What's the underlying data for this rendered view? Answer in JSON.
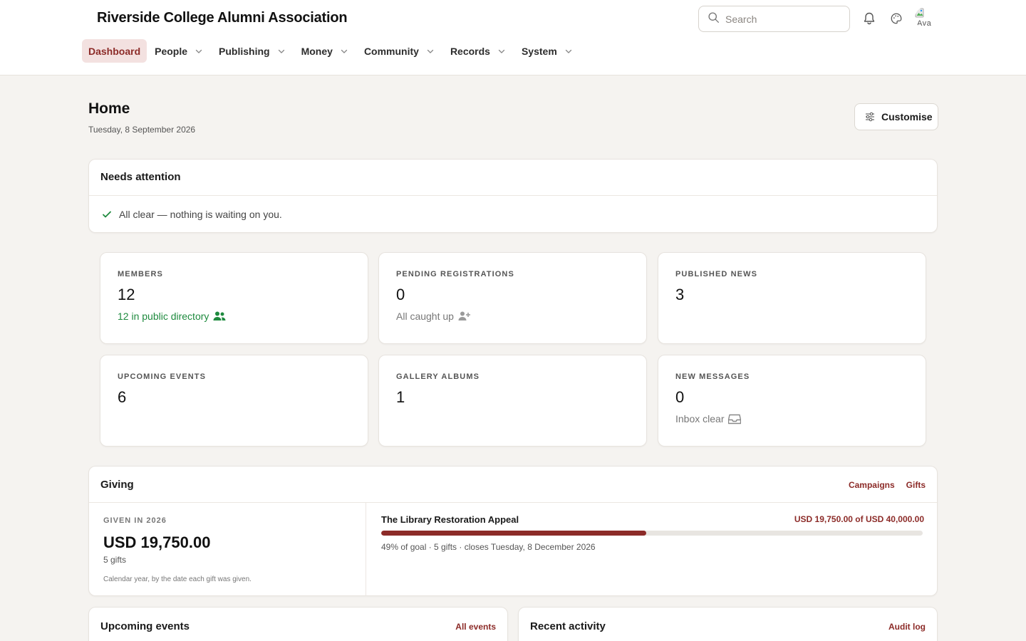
{
  "header": {
    "brand": "Riverside College Alumni Association",
    "search_placeholder": "Search",
    "avatar_alt": "Ava"
  },
  "nav": {
    "items": [
      {
        "label": "Dashboard",
        "active": true,
        "dropdown": false
      },
      {
        "label": "People",
        "active": false,
        "dropdown": true
      },
      {
        "label": "Publishing",
        "active": false,
        "dropdown": true
      },
      {
        "label": "Money",
        "active": false,
        "dropdown": true
      },
      {
        "label": "Community",
        "active": false,
        "dropdown": true
      },
      {
        "label": "Records",
        "active": false,
        "dropdown": true
      },
      {
        "label": "System",
        "active": false,
        "dropdown": true
      }
    ]
  },
  "page": {
    "title": "Home",
    "date": "Tuesday, 8 September 2026",
    "customise_label": "Customise"
  },
  "attention": {
    "title": "Needs attention",
    "message": "All clear — nothing is waiting on you."
  },
  "stats": [
    {
      "label": "MEMBERS",
      "value": "12",
      "sub": "12 in public directory",
      "sub_style": "green",
      "sub_icon": "users-icon"
    },
    {
      "label": "PENDING REGISTRATIONS",
      "value": "0",
      "sub": "All caught up",
      "sub_style": "muted",
      "sub_icon": "user-plus-icon"
    },
    {
      "label": "PUBLISHED NEWS",
      "value": "3",
      "sub": "",
      "sub_style": "",
      "sub_icon": ""
    },
    {
      "label": "UPCOMING EVENTS",
      "value": "6",
      "sub": "",
      "sub_style": "",
      "sub_icon": ""
    },
    {
      "label": "GALLERY ALBUMS",
      "value": "1",
      "sub": "",
      "sub_style": "",
      "sub_icon": ""
    },
    {
      "label": "NEW MESSAGES",
      "value": "0",
      "sub": "Inbox clear",
      "sub_style": "muted",
      "sub_icon": "inbox-icon"
    }
  ],
  "giving": {
    "title": "Giving",
    "link_campaigns": "Campaigns",
    "link_gifts": "Gifts",
    "given_label": "GIVEN IN 2026",
    "given_amount": "USD 19,750.00",
    "gift_count": "5 gifts",
    "note": "Calendar year, by the date each gift was given.",
    "campaign": {
      "name": "The Library Restoration Appeal",
      "total": "USD 19,750.00 of USD 40,000.00",
      "progress": 0.49,
      "meta": "49% of goal · 5 gifts · closes Tuesday, 8 December 2026"
    }
  },
  "upcoming_events": {
    "title": "Upcoming events",
    "link": "All events"
  },
  "recent_activity": {
    "title": "Recent activity",
    "link": "Audit log"
  },
  "colors": {
    "accent": "#8c2b28",
    "active_bg": "#f3e1e0",
    "success": "#1e8a3e",
    "page_bg": "#f5f3f0"
  }
}
